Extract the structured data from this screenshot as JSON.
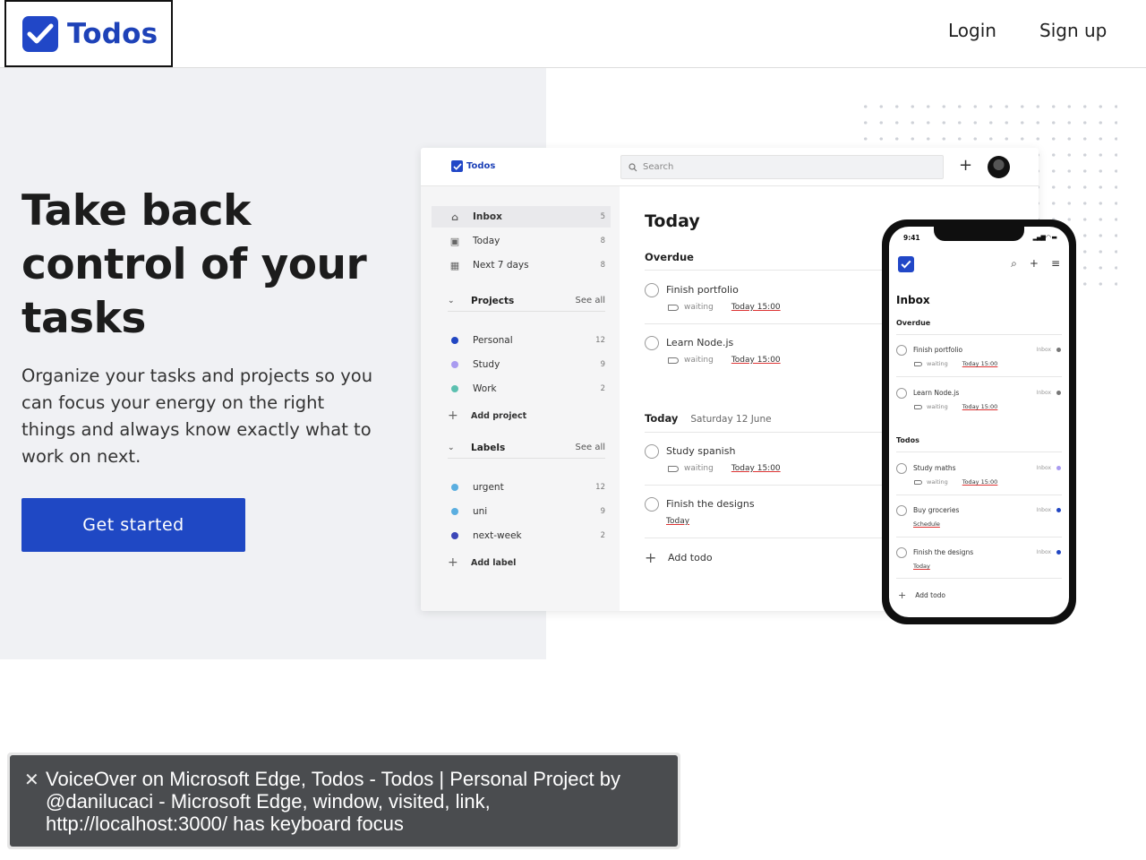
{
  "header": {
    "logo_text": "Todos",
    "login": "Login",
    "signup": "Sign up"
  },
  "hero": {
    "title": "Take back control of your tasks",
    "subtitle": "Organize your tasks and projects so you can focus your energy on the right things and always know exactly what to work on next.",
    "cta": "Get started"
  },
  "mock": {
    "logo_text": "Todos",
    "search_placeholder": "Search",
    "sidebar": {
      "nav": [
        {
          "label": "Inbox",
          "count": "5",
          "icon": "home-icon"
        },
        {
          "label": "Today",
          "count": "8",
          "icon": "calendar-day-icon"
        },
        {
          "label": "Next 7 days",
          "count": "8",
          "icon": "calendar-icon"
        }
      ],
      "projects_heading": "Projects",
      "projects_see_all": "See all",
      "projects": [
        {
          "label": "Personal",
          "count": "12",
          "color": "#2146c2"
        },
        {
          "label": "Study",
          "count": "9",
          "color": "#a99bf0"
        },
        {
          "label": "Work",
          "count": "2",
          "color": "#5cc0b0"
        }
      ],
      "add_project": "Add project",
      "labels_heading": "Labels",
      "labels_see_all": "See all",
      "labels": [
        {
          "label": "urgent",
          "count": "12",
          "color": "#5aaee0"
        },
        {
          "label": "uni",
          "count": "9",
          "color": "#5aaee0"
        },
        {
          "label": "next-week",
          "count": "2",
          "color": "#3b46b8"
        }
      ],
      "add_label": "Add label"
    },
    "main": {
      "title": "Today",
      "overdue_heading": "Overdue",
      "overdue": [
        {
          "title": "Finish portfolio",
          "label": "waiting",
          "due": "Today 15:00"
        },
        {
          "title": "Learn Node.js",
          "label": "waiting",
          "due": "Today 15:00"
        }
      ],
      "today_heading": "Today",
      "today_date": "Saturday 12 June",
      "today": [
        {
          "title": "Study spanish",
          "label": "waiting",
          "due": "Today 15:00"
        },
        {
          "title": "Finish the designs",
          "label": "",
          "due": "Today"
        }
      ],
      "add_todo": "Add todo"
    }
  },
  "phone": {
    "time": "9:41",
    "heading": "Inbox",
    "overdue_heading": "Overdue",
    "overdue": [
      {
        "title": "Finish portfolio",
        "project": "Inbox",
        "label": "waiting",
        "due": "Today 15:00",
        "color": "#777777"
      },
      {
        "title": "Learn Node.js",
        "project": "Inbox",
        "label": "waiting",
        "due": "Today 15:00",
        "color": "#777777"
      }
    ],
    "todos_heading": "Todos",
    "todos": [
      {
        "title": "Study maths",
        "project": "Inbox",
        "label": "waiting",
        "due": "Today 15:00",
        "color": "#a99bf0"
      },
      {
        "title": "Buy groceries",
        "project": "Inbox",
        "label": "",
        "due": "Schedule",
        "color": "#2146c2"
      },
      {
        "title": "Finish the designs",
        "project": "Inbox",
        "label": "",
        "due": "Today",
        "color": "#2146c2"
      }
    ],
    "add_todo": "Add todo"
  },
  "voiceover": {
    "text": "VoiceOver on Microsoft Edge, Todos - Todos | Personal Project by @danilucaci - Microsoft Edge, window, visited, link, http://localhost:3000/ has keyboard focus"
  },
  "colors": {
    "brand": "#1f48c4",
    "hero_bg": "#f0f1f4"
  }
}
